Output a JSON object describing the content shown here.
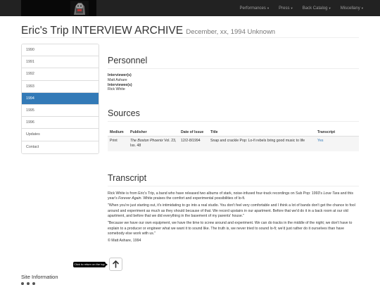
{
  "nav": {
    "items": [
      {
        "label": "Performances"
      },
      {
        "label": "Press"
      },
      {
        "label": "Back Catalog"
      },
      {
        "label": "Miscellany"
      }
    ],
    "caret": "▾"
  },
  "page": {
    "title": "Eric's Trip INTERVIEW ARCHIVE",
    "subtitle": "December, xx, 1994 Unknown"
  },
  "sidebar": {
    "items": [
      {
        "label": "1990"
      },
      {
        "label": "1991"
      },
      {
        "label": "1992"
      },
      {
        "label": "1993"
      },
      {
        "label": "1994",
        "active": true
      },
      {
        "label": "1995"
      },
      {
        "label": "1996"
      },
      {
        "label": "Updates"
      },
      {
        "label": "Contact"
      }
    ]
  },
  "personnel": {
    "heading": "Personnel",
    "interviewer_label": "Interviewer(s)",
    "interviewer": "Matt Ashare",
    "interviewee_label": "Interviewee(s)",
    "interviewee": "Rick White"
  },
  "sources": {
    "heading": "Sources",
    "columns": [
      "Medium",
      "Publisher",
      "Date of Issue",
      "Title",
      "Transcript"
    ],
    "rows": [
      {
        "medium": "Print",
        "publisher_name": "The Boston Phoenix",
        "publisher_rest": " Vol. 23, Iss. 48",
        "date": "12/2-8/1994",
        "title": "Snap and crackle Pop: Lo-fi rebels bring good music to life",
        "transcript": "Yes"
      }
    ]
  },
  "transcript": {
    "heading": "Transcript",
    "intro_a": "Rick White is from Eric's Trip, a band who have released two albums of stark, noise-infused four-track recordings on Sub Pop: 1993's ",
    "intro_album1": "Love Tara",
    "intro_b": " and this year's ",
    "intro_album2": "Forever Again",
    "intro_c": ". White praises the comfort and experimental possibilities of lo-fi.",
    "p2": "\"When you're just starting out, it's intimidating to go into a real studio. You don't feel very comfortable and I think a lot of bands don't get the chance to fool around and experiment as much as they should because of that. We record upstairs in our apartment. Before that we'd do it in a back room at our old apartment, and before that we did everything in the basement of my parents' house.\"",
    "p3": "\"Because we have our own equipment, we have the time to screw around and experiment. We can do tracks in the middle of the night; we don't have to explain to a producer or engineer what we want it to sound like. The truth is, we never tried to sound lo-fi; we'd just rather do it ourselves than have somebody else work with us.\"",
    "credit": "© Matt Ashare, 1994"
  },
  "tooltip": "Click to return on the top page",
  "footer": {
    "site_info": "Site Information"
  },
  "colors": {
    "navbar": "#222222",
    "accent": "#337ab7"
  },
  "icons": {
    "logo": "band-logo",
    "top_button": "arrow-up-icon"
  }
}
